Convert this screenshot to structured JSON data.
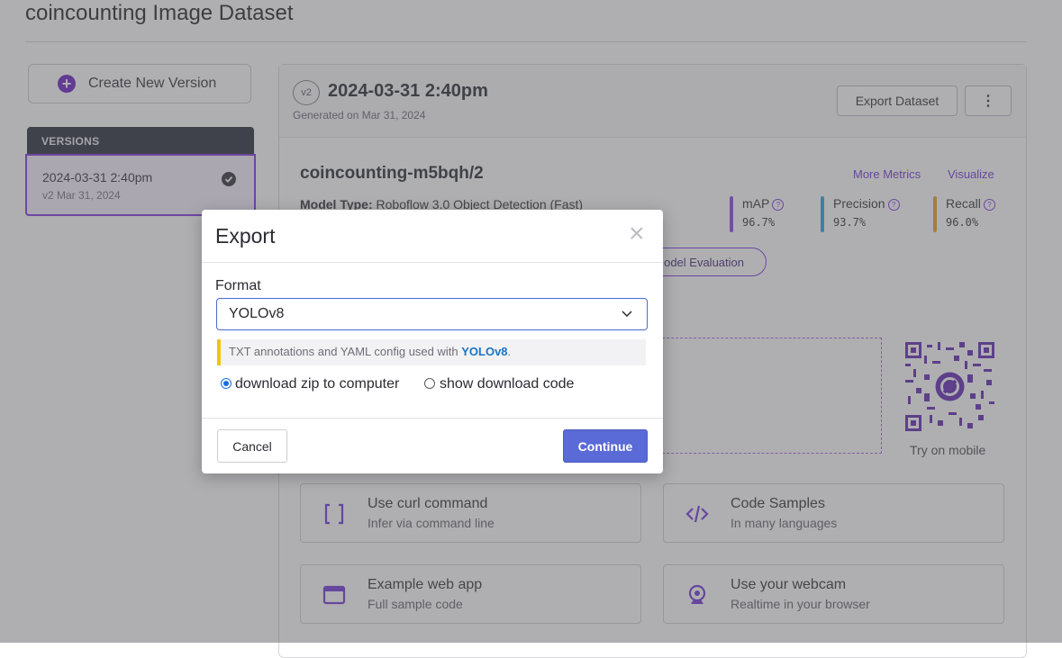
{
  "page": {
    "title": "coincounting Image Dataset"
  },
  "sidebar": {
    "create_label": "Create New Version",
    "versions_header": "VERSIONS",
    "versions": [
      {
        "name": "2024-03-31 2:40pm",
        "sub": "v2 Mar 31, 2024"
      }
    ]
  },
  "version": {
    "badge": "v2",
    "title": "2024-03-31 2:40pm",
    "generated": "Generated on Mar 31, 2024",
    "export_label": "Export Dataset",
    "more_label": "⋮"
  },
  "model": {
    "name": "coincounting-m5bqh/2",
    "more_metrics": "More Metrics",
    "visualize": "Visualize",
    "type_label": "Model Type:",
    "type_value": "Roboflow 3.0 Object Detection (Fast)",
    "metrics": [
      {
        "label": "mAP",
        "value": "96.7%",
        "color": "#8b3fd9"
      },
      {
        "label": "Precision",
        "value": "93.7%",
        "color": "#2a9fd6"
      },
      {
        "label": "Recall",
        "value": "96.0%",
        "color": "#e0a020"
      }
    ],
    "eval_label": "odel Evaluation"
  },
  "mobile": {
    "caption": "Try on mobile"
  },
  "tiles": [
    {
      "title": "Use curl command",
      "sub": "Infer via command line",
      "icon": "brackets-icon"
    },
    {
      "title": "Code Samples",
      "sub": "In many languages",
      "icon": "code-icon"
    },
    {
      "title": "Example web app",
      "sub": "Full sample code",
      "icon": "browser-window-icon"
    },
    {
      "title": "Use your webcam",
      "sub": "Realtime in your browser",
      "icon": "webcam-icon"
    }
  ],
  "modal": {
    "title": "Export",
    "close": "×",
    "format_label": "Format",
    "format_value": "YOLOv8",
    "hint_text": "TXT annotations and YAML config used with ",
    "hint_link": "YOLOv8",
    "hint_end": ".",
    "option_zip": "download zip to computer",
    "option_code": "show download code",
    "selected_option": "download zip to computer",
    "cancel_label": "Cancel",
    "continue_label": "Continue"
  },
  "colors": {
    "accent": "#6417c5",
    "primary_button": "#5a6ad6"
  }
}
